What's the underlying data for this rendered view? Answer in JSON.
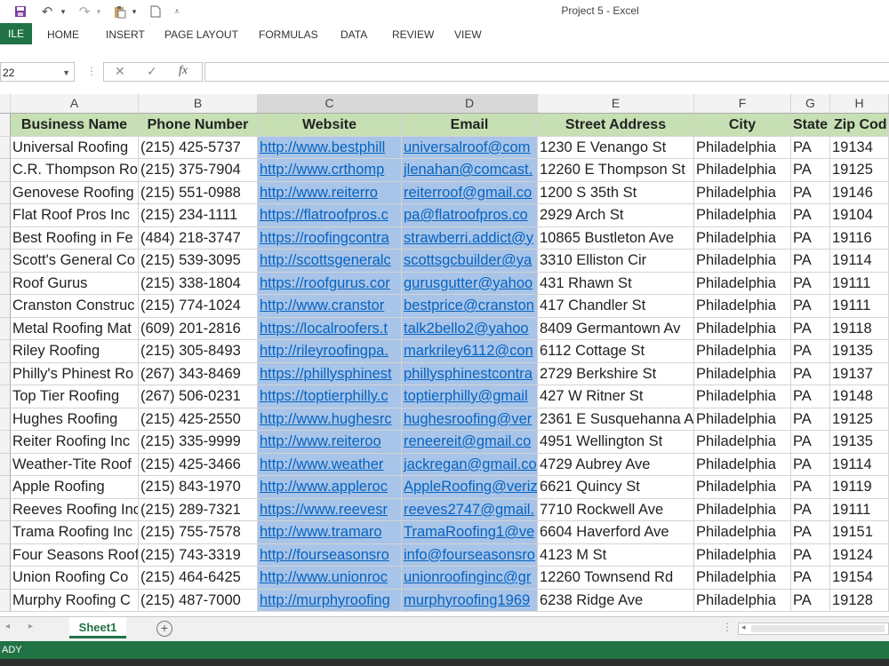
{
  "window": {
    "title": "Project 5 - Excel"
  },
  "quick_access": {
    "undo_icon": "↶",
    "redo_icon": "↷",
    "dropdown_icon": "▾"
  },
  "ribbon": {
    "file_label": "ILE",
    "tabs": [
      "HOME",
      "INSERT",
      "PAGE LAYOUT",
      "FORMULAS",
      "DATA",
      "REVIEW",
      "VIEW"
    ]
  },
  "formula_bar": {
    "name_box": "22",
    "cancel_icon": "✕",
    "enter_icon": "✓",
    "fx_label": "fx",
    "formula": ""
  },
  "columns": [
    "A",
    "B",
    "C",
    "D",
    "E",
    "F",
    "G",
    "H"
  ],
  "headers": [
    "Business Name",
    "Phone Number",
    "Website",
    "Email",
    "Street Address",
    "City",
    "State",
    "Zip Cod"
  ],
  "rows": [
    [
      "Universal Roofing",
      "(215) 425-5737",
      "http://www.bestphill",
      "universalroof@com",
      "1230 E Venango St",
      "Philadelphia",
      "PA",
      "19134"
    ],
    [
      "C.R. Thompson Ro",
      "(215) 375-7904",
      "http://www.crthomp",
      "jlenahan@comcast.",
      "12260 E Thompson St",
      "Philadelphia",
      "PA",
      "19125"
    ],
    [
      "Genovese Roofing",
      "(215) 551-0988",
      "http://www.reiterro",
      "reiterroof@gmail.co",
      "1200 S 35th St",
      "Philadelphia",
      "PA",
      "19146"
    ],
    [
      "Flat Roof Pros Inc",
      "(215) 234-1111",
      "https://flatroofpros.c",
      "pa@flatroofpros.co",
      "2929 Arch St",
      "Philadelphia",
      "PA",
      "19104"
    ],
    [
      "Best Roofing in Fe",
      "(484) 218-3747",
      "https://roofingcontra",
      "strawberri.addict@y",
      "10865 Bustleton Ave",
      "Philadelphia",
      "PA",
      "19116"
    ],
    [
      "Scott's General Co",
      "(215) 539-3095",
      "http://scottsgeneralc",
      "scottsgcbuilder@ya",
      "3310 Elliston Cir",
      "Philadelphia",
      "PA",
      "19114"
    ],
    [
      "Roof Gurus",
      "(215) 338-1804",
      "https://roofgurus.cor",
      "gurusgutter@yahoo",
      "431 Rhawn St",
      "Philadelphia",
      "PA",
      "19111"
    ],
    [
      "Cranston Construc",
      "(215) 774-1024",
      "http://www.cranstor",
      "bestprice@cranston",
      "417 Chandler St",
      "Philadelphia",
      "PA",
      "19111"
    ],
    [
      "Metal Roofing Mat",
      "(609) 201-2816",
      "https://localroofers.t",
      "talk2bello2@yahoo",
      "8409 Germantown Av",
      "Philadelphia",
      "PA",
      "19118"
    ],
    [
      "Riley Roofing",
      "(215) 305-8493",
      "http://rileyroofingpa.",
      "markriley6112@con",
      "6112 Cottage St",
      "Philadelphia",
      "PA",
      "19135"
    ],
    [
      "Philly's Phinest Ro",
      "(267) 343-8469",
      "https://phillysphinest",
      "phillysphinestcontra",
      "2729 Berkshire St",
      "Philadelphia",
      "PA",
      "19137"
    ],
    [
      "Top Tier Roofing",
      "(267) 506-0231",
      "https://toptierphilly.c",
      "toptierphilly@gmail",
      "427 W Ritner St",
      "Philadelphia",
      "PA",
      "19148"
    ],
    [
      "Hughes Roofing",
      "(215) 425-2550",
      "http://www.hughesrc",
      "hughesroofing@ver",
      "2361 E Susquehanna A",
      "Philadelphia",
      "PA",
      "19125"
    ],
    [
      "Reiter Roofing Inc",
      "(215) 335-9999",
      "http://www.reiteroo",
      "reneereit@gmail.co",
      "4951 Wellington St",
      "Philadelphia",
      "PA",
      "19135"
    ],
    [
      "Weather-Tite Roof",
      "(215) 425-3466",
      "http://www.weather",
      "jackregan@gmail.co",
      "4729 Aubrey Ave",
      "Philadelphia",
      "PA",
      "19114"
    ],
    [
      "Apple Roofing",
      "(215) 843-1970",
      "http://www.appleroc",
      "AppleRoofing@veriz",
      "6621 Quincy St",
      "Philadelphia",
      "PA",
      "19119"
    ],
    [
      "Reeves Roofing Inc",
      "(215) 289-7321",
      "https://www.reevesr",
      "reeves2747@gmail.",
      "7710 Rockwell Ave",
      "Philadelphia",
      "PA",
      "19111"
    ],
    [
      "Trama Roofing Inc",
      "(215) 755-7578",
      "http://www.tramaro",
      "TramaRoofing1@ve",
      "6604 Haverford Ave",
      "Philadelphia",
      "PA",
      "19151"
    ],
    [
      "Four Seasons Roof",
      "(215) 743-3319",
      "http://fourseasonsro",
      "info@fourseasonsro",
      "4123 M St",
      "Philadelphia",
      "PA",
      "19124"
    ],
    [
      "Union Roofing Co",
      "(215) 464-6425",
      "http://www.unionroc",
      "unionroofinginc@gr",
      "12260 Townsend Rd",
      "Philadelphia",
      "PA",
      "19154"
    ],
    [
      "Murphy Roofing C",
      "(215) 487-7000",
      "http://murphyroofing",
      "murphyroofing1969",
      "6238 Ridge Ave",
      "Philadelphia",
      "PA",
      "19128"
    ]
  ],
  "sheets": {
    "active": "Sheet1",
    "add_icon": "+"
  },
  "status": {
    "text": "ADY"
  }
}
